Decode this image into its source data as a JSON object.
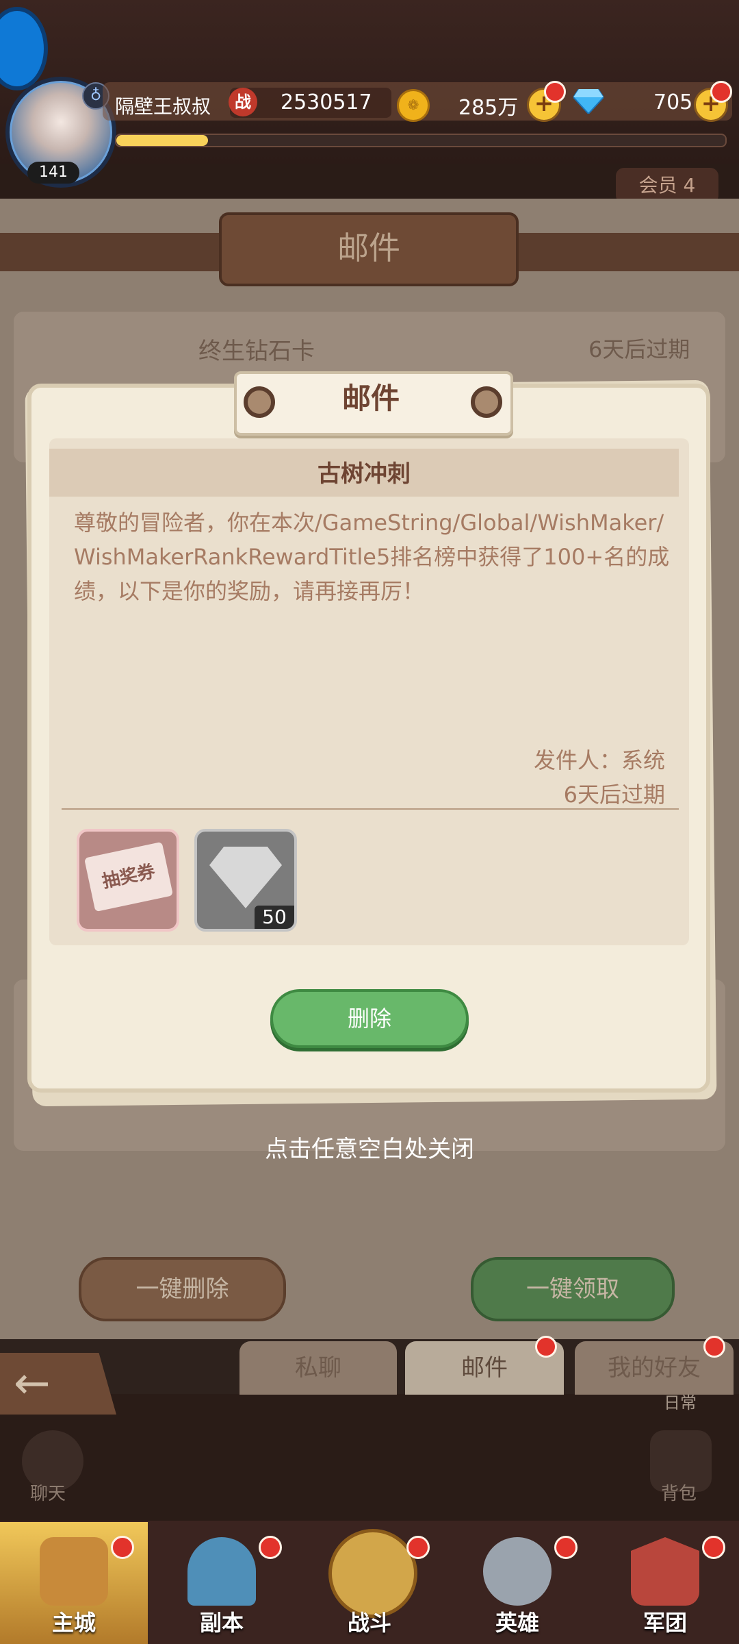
{
  "topbar": {
    "player_name": "隔壁王叔叔",
    "level": "141",
    "power_icon": "战",
    "power_value": "2530517",
    "gold_value": "285万",
    "gems_value": "705",
    "xp_percent": 15,
    "vip_label": "会员 4"
  },
  "background": {
    "title": "邮件",
    "item1_title": "终生钻石卡",
    "item1_expire": "6天后过期",
    "close_hint": "点击任意空白处关闭",
    "delete_all": "一键删除",
    "claim_all": "一键领取",
    "tabs": {
      "pm": "私聊",
      "mail": "邮件",
      "friends": "我的好友"
    },
    "daily": "日常",
    "chat": "聊天",
    "bag": "背包"
  },
  "dialog": {
    "title": "邮件",
    "subject": "古树冲刺",
    "body": "尊敬的冒险者，你在本次/GameString/Global/WishMaker/WishMakerRankRewardTitle5排名榜中获得了100+名的成绩，以下是你的奖励，请再接再厉！",
    "sender": "发件人：系统",
    "expire": "6天后过期",
    "reward1_label": "抽奖券",
    "reward2_count": "50",
    "delete_button": "删除"
  },
  "nav": [
    {
      "label": "主城"
    },
    {
      "label": "副本"
    },
    {
      "label": "战斗"
    },
    {
      "label": "英雄"
    },
    {
      "label": "军团"
    }
  ]
}
